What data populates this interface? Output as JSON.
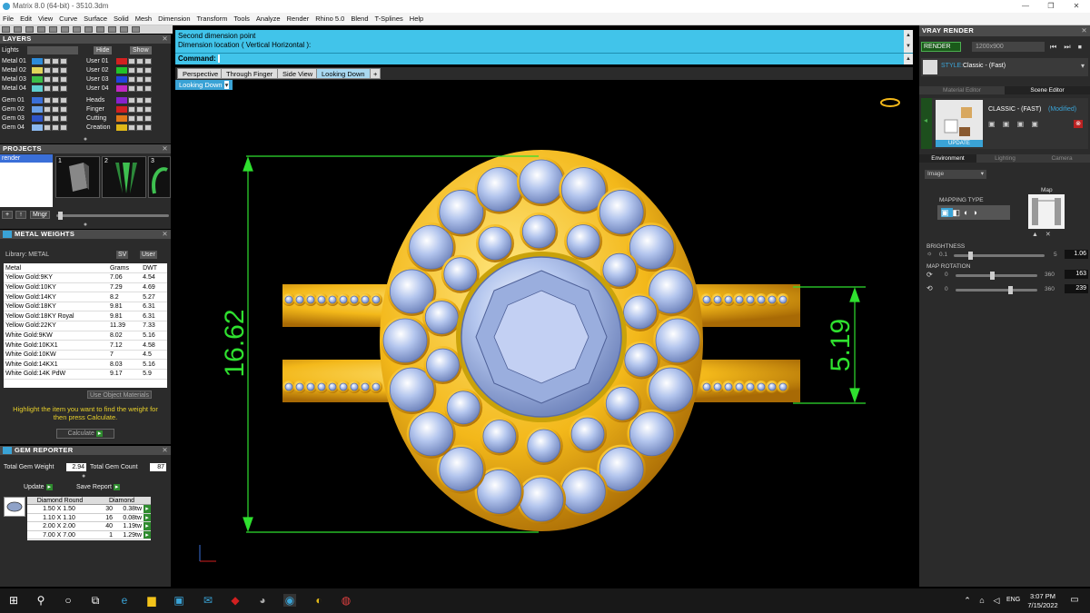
{
  "window": {
    "title": "Matrix 8.0 (64-bit) - 3510.3dm",
    "minimize": "—",
    "restore": "❐",
    "close": "✕"
  },
  "menu": [
    "File",
    "Edit",
    "View",
    "Curve",
    "Surface",
    "Solid",
    "Mesh",
    "Dimension",
    "Transform",
    "Tools",
    "Analyze",
    "Render",
    "Rhino 5.0",
    "Blend",
    "T-Splines",
    "Help"
  ],
  "layers": {
    "title": "LAYERS",
    "lights_label": "Lights",
    "hide_label": "Hide",
    "show_label": "Show",
    "left": [
      {
        "label": "Metal 01",
        "color": "#2d8bd9"
      },
      {
        "label": "Metal 02",
        "color": "#e0d65a"
      },
      {
        "label": "Metal 03",
        "color": "#3bbf48"
      },
      {
        "label": "Metal 04",
        "color": "#5fd0d0"
      },
      {
        "label": "Gem 01",
        "color": "#3a6fd8"
      },
      {
        "label": "Gem 02",
        "color": "#6aa0e8"
      },
      {
        "label": "Gem 03",
        "color": "#2f55c8"
      },
      {
        "label": "Gem 04",
        "color": "#8bb9f0"
      }
    ],
    "right": [
      {
        "label": "User 01",
        "color": "#d22020"
      },
      {
        "label": "User 02",
        "color": "#22c22a"
      },
      {
        "label": "User 03",
        "color": "#2244dd"
      },
      {
        "label": "User 04",
        "color": "#c228c2"
      },
      {
        "label": "Heads",
        "color": "#8822cc"
      },
      {
        "label": "Finger",
        "color": "#d22020"
      },
      {
        "label": "Cutting",
        "color": "#e07818"
      },
      {
        "label": "Creation",
        "color": "#e0b818"
      }
    ]
  },
  "projects": {
    "title": "PROJECTS",
    "selected": "render",
    "thumbs": [
      "1",
      "2",
      "3"
    ],
    "mngr": "Mngr",
    "plus": "+",
    "up": "↑"
  },
  "metal_weights": {
    "title": "METAL WEIGHTS",
    "library": "Library: METAL",
    "sv": "SV",
    "user": "User",
    "columns": [
      "Metal",
      "Grams",
      "DWT"
    ],
    "rows": [
      [
        "Yellow Gold:9KY",
        "7.06",
        "4.54"
      ],
      [
        "Yellow Gold:10KY",
        "7.29",
        "4.69"
      ],
      [
        "Yellow Gold:14KY",
        "8.2",
        "5.27"
      ],
      [
        "Yellow Gold:18KY",
        "9.81",
        "6.31"
      ],
      [
        "Yellow Gold:18KY Royal",
        "9.81",
        "6.31"
      ],
      [
        "Yellow Gold:22KY",
        "11.39",
        "7.33"
      ],
      [
        "White Gold:9KW",
        "8.02",
        "5.16"
      ],
      [
        "White Gold:10KX1",
        "7.12",
        "4.58"
      ],
      [
        "White Gold:10KW",
        "7",
        "4.5"
      ],
      [
        "White Gold:14KX1",
        "8.03",
        "5.16"
      ],
      [
        "White Gold:14K PdW",
        "9.17",
        "5.9"
      ]
    ],
    "use_object_materials": "Use Object Materials",
    "hint": "Highlight the item you want to find the weight for then press Calculate.",
    "calculate": "Calculate"
  },
  "gem_reporter": {
    "title": "GEM REPORTER",
    "total_weight_label": "Total Gem Weight",
    "total_weight": "2.94",
    "total_count_label": "Total Gem Count",
    "total_count": "87",
    "update": "Update",
    "save_report": "Save Report",
    "shape_header": "Diamond Round",
    "type_header": "Diamond",
    "rows": [
      [
        "1.50 X 1.50",
        "30",
        "0.38tw"
      ],
      [
        "1.10 X 1.10",
        "16",
        "0.08tw"
      ],
      [
        "2.00 X 2.00",
        "40",
        "1.19tw"
      ],
      [
        "7.00 X 7.00",
        "1",
        "1.29tw"
      ]
    ]
  },
  "command": {
    "line1": "Second dimension point",
    "line2": "Dimension location ( Vertical  Horizontal ):",
    "prompt": "Command:"
  },
  "viewport": {
    "tabs": [
      "Perspective",
      "Through Finger",
      "Side View",
      "Looking Down"
    ],
    "add_tab": "+",
    "active": "Looking Down",
    "dropdown": "Looking Down",
    "dim_height": "16.62",
    "dim_band": "5.19"
  },
  "vray": {
    "title": "VRAY RENDER",
    "render": "RENDER",
    "resolution": "1200x900",
    "style_label": "STYLE:",
    "style_value": "Classic - (Fast)",
    "tabs_top": [
      "Material Editor",
      "Scene Editor"
    ],
    "preset_name": "CLASSIC - (FAST)",
    "preset_status": "(Modified)",
    "update": "UPDATE",
    "tabs_env": [
      "Environment",
      "Lighting",
      "Camera"
    ],
    "env_type": "Image",
    "mapping_type": "MAPPING TYPE",
    "map_label": "Map",
    "brightness_label": "BRIGHTNESS",
    "brightness_min": "0.1",
    "brightness_max": "5",
    "brightness_value": "1.06",
    "map_rotation_label": "MAP ROTATION",
    "rot1_min": "0",
    "rot1_max": "360",
    "rot1_value": "163",
    "rot2_min": "0",
    "rot2_max": "360",
    "rot2_value": "239"
  },
  "taskbar": {
    "time": "3:07 PM",
    "date": "7/15/2022",
    "lang": "ENG"
  }
}
